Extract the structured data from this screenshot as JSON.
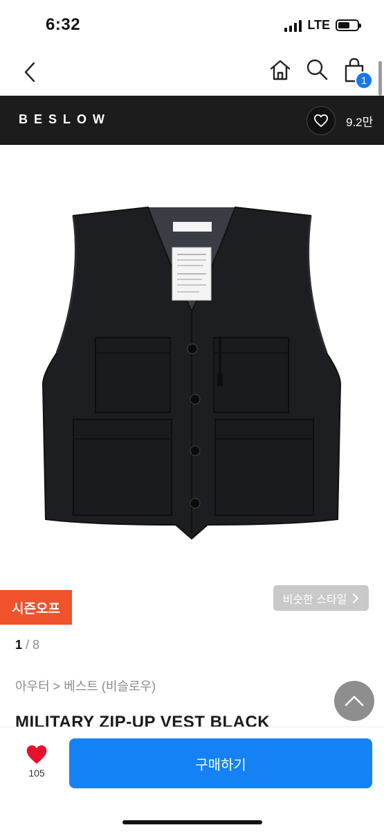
{
  "status": {
    "time": "6:32",
    "network": "LTE"
  },
  "nav": {
    "back_icon": "chevron-left-icon",
    "home_icon": "home-icon",
    "search_icon": "search-icon",
    "cart_icon": "shopping-bag-icon",
    "cart_count": "1"
  },
  "brand": {
    "name": "BESLOW",
    "like_count": "9.2만"
  },
  "product": {
    "image_alt": "black military vest",
    "season_tag": "시즌오프",
    "similar_style": "비슷한 스타일",
    "page_current": "1",
    "page_total": "8",
    "breadcrumb": "아우터 > 베스트 (비슬로우)",
    "title": "MILITARY ZIP-UP VEST BLACK"
  },
  "bottom": {
    "wish_count": "105",
    "buy_label": "구매하기"
  },
  "colors": {
    "accent_blue": "#1482f5",
    "season_tag": "#f0522b",
    "brand_bar": "#1c1c1c",
    "heart_red": "#e8112d"
  }
}
